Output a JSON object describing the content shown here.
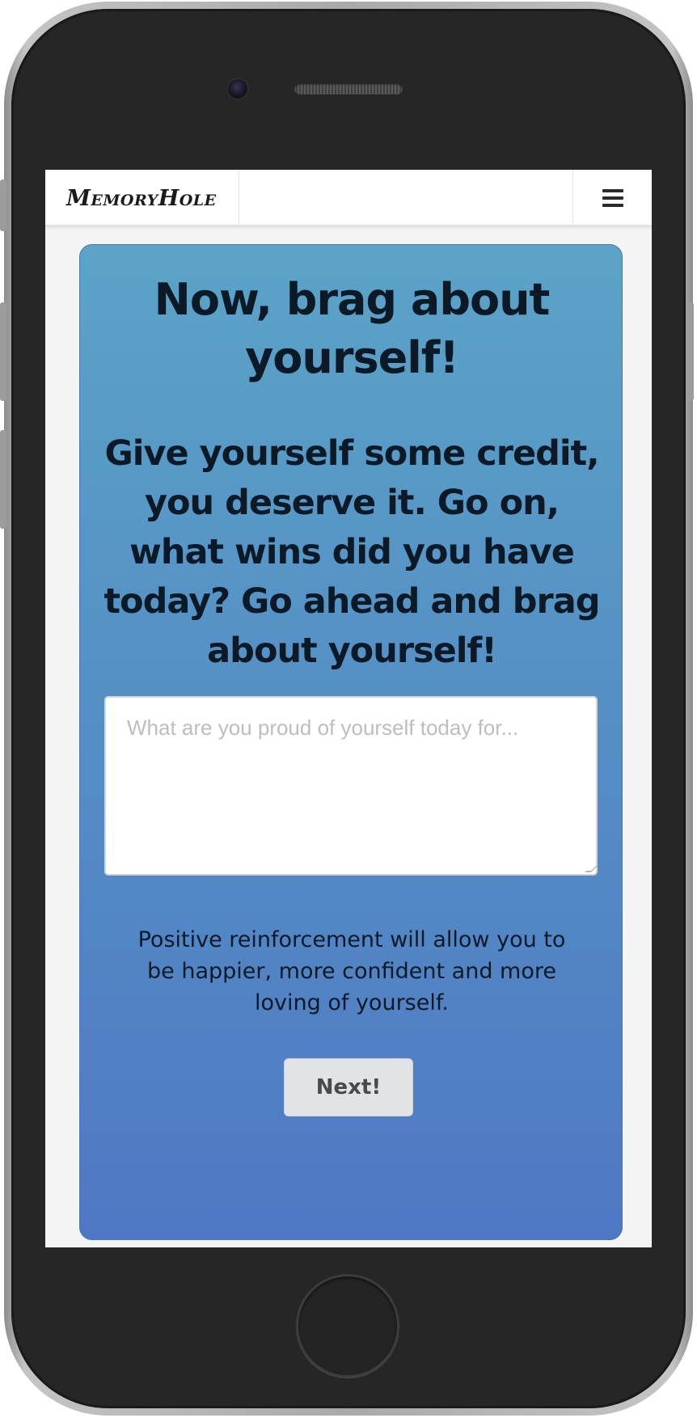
{
  "app": {
    "brand": "MemoryHole"
  },
  "navbar": {
    "menu_icon": "hamburger-menu-icon"
  },
  "card": {
    "title": "Now, brag about yourself!",
    "subtitle": "Give yourself some credit, you deserve it. Go on, what wins did you have today? Go ahead and brag about yourself!",
    "input": {
      "placeholder": "What are you proud of yourself today for...",
      "value": ""
    },
    "note": "Positive reinforcement will allow you to be happier, more confident and more loving of yourself.",
    "next_label": "Next!"
  },
  "colors": {
    "card_top": "#5ba3c7",
    "card_bottom": "#4f78c4",
    "heading_text": "#0b1a26",
    "button_bg": "#e1e4e7"
  }
}
